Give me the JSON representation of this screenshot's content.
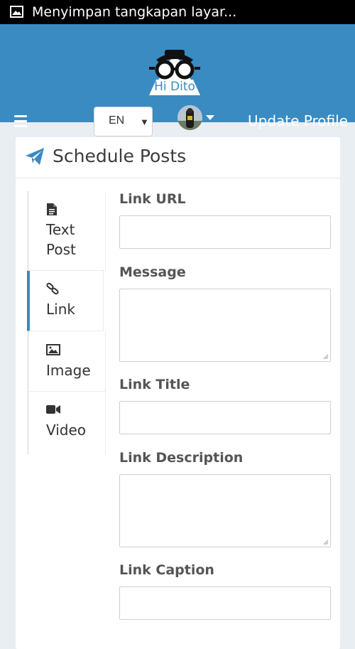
{
  "status_bar": {
    "text": "Menyimpan tangkapan layar..."
  },
  "header": {
    "logo_text": "Hi Dito",
    "language": "EN",
    "update_profile": "Update Profile"
  },
  "card": {
    "title": "Schedule Posts",
    "tabs": [
      {
        "label_line1": "Text",
        "label_line2": "Post",
        "icon": "document-icon"
      },
      {
        "label_line1": "Link",
        "label_line2": "",
        "icon": "link-icon"
      },
      {
        "label_line1": "Image",
        "label_line2": "",
        "icon": "image-icon"
      },
      {
        "label_line1": "Video",
        "label_line2": "",
        "icon": "video-camera-icon"
      }
    ],
    "active_tab": "Link",
    "fields": {
      "link_url": {
        "label": "Link URL",
        "value": ""
      },
      "message": {
        "label": "Message",
        "value": ""
      },
      "link_title": {
        "label": "Link Title",
        "value": ""
      },
      "link_description": {
        "label": "Link Description",
        "value": ""
      },
      "link_caption": {
        "label": "Link Caption",
        "value": ""
      }
    }
  },
  "colors": {
    "header": "#3a8bc2",
    "background": "#e9eef3",
    "accent": "#3a8bc2"
  }
}
